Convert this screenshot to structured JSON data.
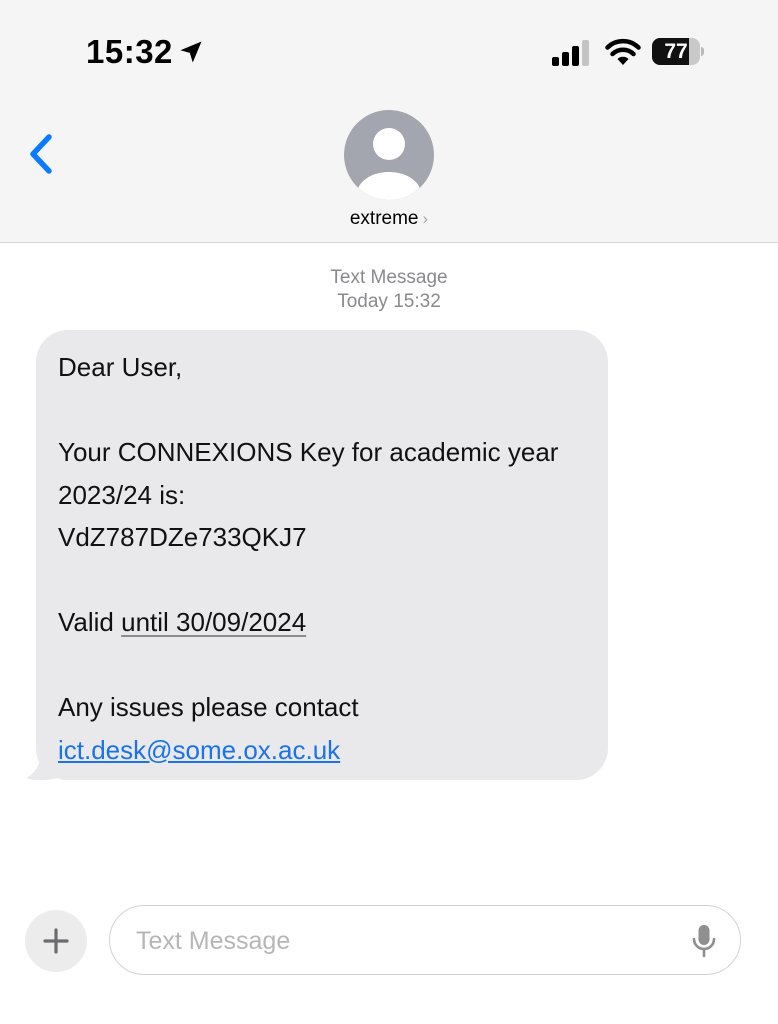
{
  "status_bar": {
    "time": "15:32",
    "battery": "77",
    "battery_level": 0.77,
    "icons": [
      "location-arrow-icon",
      "cellular-signal-icon",
      "wifi-icon",
      "battery-icon"
    ]
  },
  "header": {
    "back_icon": "chevron-left-icon",
    "contact_name": "extreme",
    "contact_chevron": "›",
    "avatar_icon": "person-silhouette-icon"
  },
  "thread": {
    "service_label": "Text Message",
    "timestamp": "Today 15:32"
  },
  "message": {
    "line1": "Dear User,",
    "line2": "Your CONNEXIONS Key for academic year",
    "line3": "2023/24 is:",
    "line4": "VdZ787DZe733QKJ7",
    "line5_prefix": "Valid ",
    "line5_date": "until 30/09/2024",
    "line6": "Any issues please contact",
    "email": "ict.desk@some.ox.ac.uk"
  },
  "composer": {
    "plus_label": "+",
    "placeholder": "Text Message",
    "value": "",
    "mic_icon": "microphone-icon"
  },
  "colors": {
    "accent": "#0a7aff",
    "bubble": "#e9e9eb",
    "link": "#1a73e8",
    "header_bg": "#f5f5f5"
  }
}
